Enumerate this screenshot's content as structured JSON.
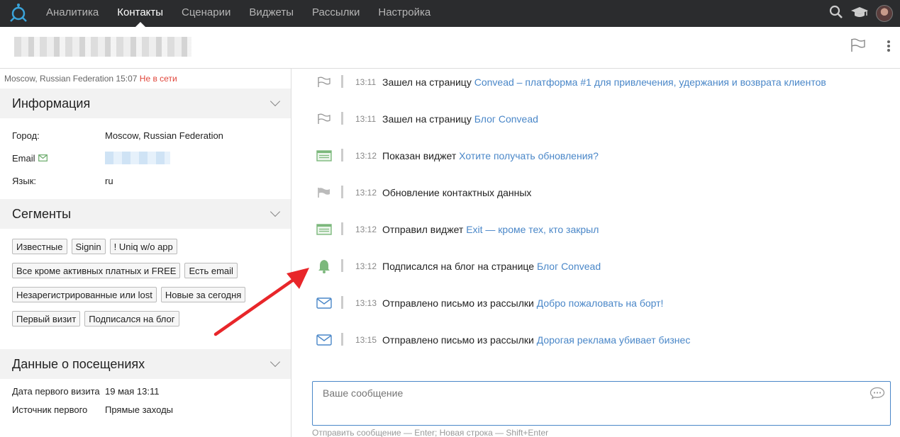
{
  "nav": {
    "items": [
      {
        "label": "Аналитика",
        "active": false
      },
      {
        "label": "Контакты",
        "active": true
      },
      {
        "label": "Сценарии",
        "active": false
      },
      {
        "label": "Виджеты",
        "active": false
      },
      {
        "label": "Рассылки",
        "active": false
      },
      {
        "label": "Настройка",
        "active": false
      }
    ],
    "icons": [
      "logo-icon",
      "search-icon",
      "graduation-cap-icon",
      "avatar"
    ]
  },
  "status": {
    "location": "Moscow, Russian Federation",
    "time": "15:07",
    "online": "Не в сети"
  },
  "info": {
    "title": "Информация",
    "rows": [
      {
        "key": "Город:",
        "value": "Moscow, Russian Federation"
      },
      {
        "key": "Email",
        "value": ""
      },
      {
        "key": "Язык:",
        "value": "ru"
      }
    ]
  },
  "segments": {
    "title": "Сегменты",
    "tags": [
      "Известные",
      "Signin",
      "! Uniq w/o app",
      "Все кроме активных платных и FREE",
      "Есть email",
      "Незарегистрированные или lost",
      "Новые за сегодня",
      "Первый визит",
      "Подписался на блог"
    ]
  },
  "visits": {
    "title": "Данные о посещениях",
    "rows": [
      {
        "key": "Дата первого визита",
        "value": "19 мая 13:11"
      },
      {
        "key": "Источник первого",
        "value": "Прямые заходы"
      }
    ]
  },
  "events": [
    {
      "time": "13:11",
      "text": "Зашел на страницу ",
      "link": "Convead – платформа #1 для привлечения, удержания и возврата клиентов",
      "icon": "flag-outline-icon"
    },
    {
      "time": "13:11",
      "text": "Зашел на страницу ",
      "link": "Блог Convead",
      "icon": "flag-outline-icon"
    },
    {
      "time": "13:12",
      "text": "Показан виджет ",
      "link": "Хотите получать обновления?",
      "icon": "widget-icon"
    },
    {
      "time": "13:12",
      "text": "Обновление контактных данных",
      "link": "",
      "icon": "flag-filled-icon"
    },
    {
      "time": "13:12",
      "text": "Отправил виджет ",
      "link": "Exit — кроме тех, кто закрыл",
      "icon": "widget-icon"
    },
    {
      "time": "13:12",
      "text": "Подписался на блог на странице ",
      "link": "Блог Convead",
      "icon": "bell-icon"
    },
    {
      "time": "13:13",
      "text": "Отправлено письмо из рассылки ",
      "link": "Добро пожаловать на борт!",
      "icon": "envelope-icon"
    },
    {
      "time": "13:15",
      "text": "Отправлено письмо из рассылки ",
      "link": "Дорогая реклама убивает бизнес",
      "icon": "envelope-icon"
    }
  ],
  "message": {
    "placeholder": "Ваше сообщение",
    "hint": "Отправить сообщение — Enter; Новая строка — Shift+Enter"
  },
  "colors": {
    "accent": "#4a87c8",
    "offline": "#e0453a",
    "green": "#7cb87c",
    "arrow": "#e8262a"
  }
}
